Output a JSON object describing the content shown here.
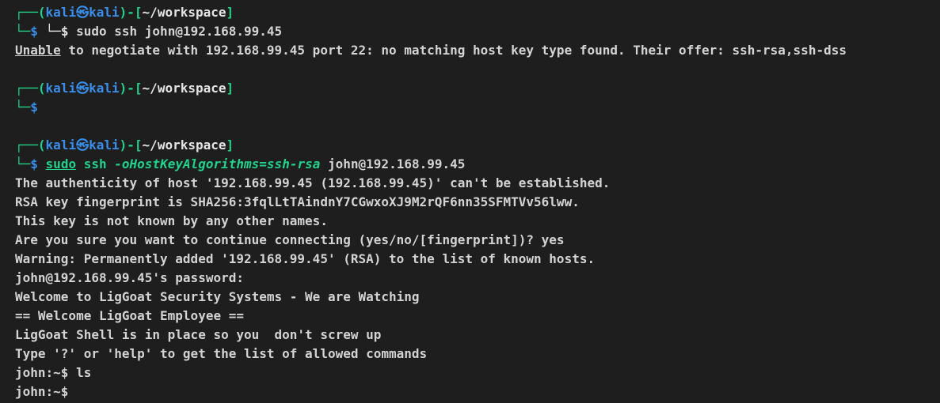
{
  "prompt": {
    "user": "kali",
    "at": "㉿",
    "host": "kali",
    "cwd": "~/workspace",
    "corner_top": "┌──",
    "corner_bottom": "└─",
    "dollar": "$",
    "open_paren": "(",
    "close_paren": ")",
    "dash": "-",
    "open_bracket": "[",
    "close_bracket": "]"
  },
  "block1": {
    "stray": "└─",
    "command": "sudo ssh john@192.168.99.45",
    "out_underlined": "Unable",
    "out_rest": " to negotiate with 192.168.99.45 port 22: no matching host key type found. Their offer: ssh-rsa,ssh-dss"
  },
  "block3": {
    "cmd_sudo": "sudo",
    "cmd_ssh": "ssh",
    "cmd_opt": "-oHostKeyAlgorithms=ssh-rsa",
    "cmd_target": "john@192.168.99.45",
    "output": [
      "The authenticity of host '192.168.99.45 (192.168.99.45)' can't be established.",
      "RSA key fingerprint is SHA256:3fqlLtTAindnY7CGwxoXJ9M2rQF6nn35SFMTVv56lww.",
      "This key is not known by any other names.",
      "Are you sure you want to continue connecting (yes/no/[fingerprint])? yes",
      "Warning: Permanently added '192.168.99.45' (RSA) to the list of known hosts.",
      "john@192.168.99.45's password:",
      "Welcome to LigGoat Security Systems - We are Watching",
      "== Welcome LigGoat Employee ==",
      "LigGoat Shell is in place so you  don't screw up",
      "Type '?' or 'help' to get the list of allowed commands",
      "john:~$ ls",
      "john:~$"
    ]
  }
}
